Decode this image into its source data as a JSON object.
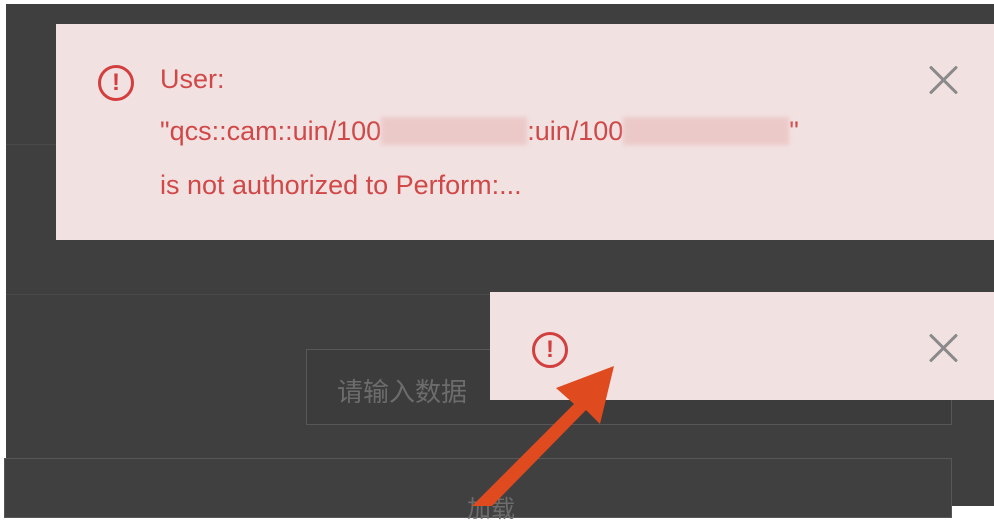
{
  "background": {
    "input_placeholder": "请输入数据",
    "button_label": "加载"
  },
  "toast_main": {
    "line1": "User:",
    "line2_prefix": "\"qcs::cam::uin/100",
    "line2_middle": ":uin/100",
    "line2_suffix": "\"",
    "line3": "is not authorized to Perform:...",
    "icon": "exclamation-circle-icon",
    "close_icon": "close-icon"
  },
  "toast_small": {
    "icon": "exclamation-circle-icon",
    "close_icon": "close-icon"
  },
  "annotation": {
    "arrow_color": "#e04a1f"
  },
  "colors": {
    "toast_bg": "#f2e1e1",
    "toast_text": "#d04848",
    "backdrop": "#3f3f3f"
  }
}
